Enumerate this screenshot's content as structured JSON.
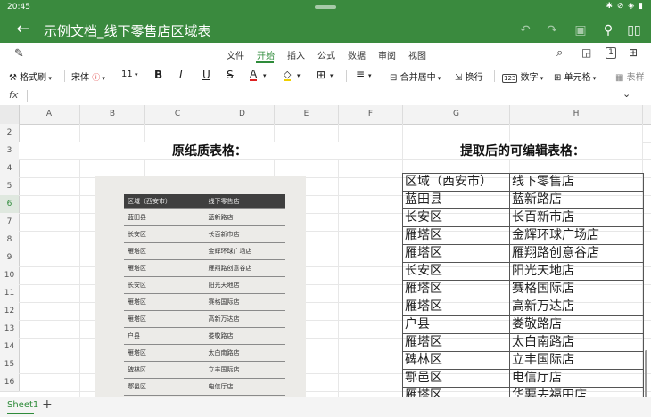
{
  "status_bar": {
    "time": "20:45",
    "icons": "✱ ⊘ ◈ ▮"
  },
  "title_bar": {
    "title": "示例文档_线下零售店区域表"
  },
  "menu_tabs": [
    "文件",
    "开始",
    "插入",
    "公式",
    "数据",
    "审阅",
    "视图"
  ],
  "toolbar": {
    "format_painter": "格式刷",
    "font_name": "宋体",
    "font_size": "11",
    "bold": "B",
    "italic": "I",
    "underline": "U",
    "strike": "S",
    "font_color": "A",
    "merge_center": "合并居中",
    "wrap": "换行",
    "number": "数字",
    "cell": "单元格",
    "table_style": "表样"
  },
  "formula_bar": {
    "fx_label": "fx",
    "value": ""
  },
  "columns": [
    "A",
    "B",
    "C",
    "D",
    "E",
    "F",
    "G",
    "H"
  ],
  "rows": [
    "2",
    "3",
    "4",
    "5",
    "6",
    "7",
    "8",
    "9",
    "10",
    "11",
    "12",
    "13",
    "14",
    "15",
    "16"
  ],
  "selected_row": "6",
  "headings": {
    "left": "原纸质表格：",
    "right": "提取后的可编辑表格："
  },
  "paper_table": {
    "header": [
      "区域（西安市）",
      "线下零售店"
    ],
    "rows": [
      [
        "蓝田县",
        "蓝新路店"
      ],
      [
        "长安区",
        "长百新市店"
      ],
      [
        "雁塔区",
        "金辉环球广场店"
      ],
      [
        "雁塔区",
        "雁翔路创意谷店"
      ],
      [
        "长安区",
        "阳光天地店"
      ],
      [
        "雁塔区",
        "赛格国际店"
      ],
      [
        "雁塔区",
        "高新万达店"
      ],
      [
        "户县",
        "娄敬路店"
      ],
      [
        "雁塔区",
        "太白南路店"
      ],
      [
        "碑林区",
        "立丰国际店"
      ],
      [
        "鄠邑区",
        "电信厅店"
      ]
    ]
  },
  "editable_table": {
    "rows": [
      [
        "区域（西安市）",
        "线下零售店"
      ],
      [
        "蓝田县",
        "蓝新路店"
      ],
      [
        "长安区",
        "长百新市店"
      ],
      [
        "雁塔区",
        "金辉环球广场店"
      ],
      [
        "雁塔区",
        "雁翔路创意谷店"
      ],
      [
        "长安区",
        "阳光天地店"
      ],
      [
        "雁塔区",
        "赛格国际店"
      ],
      [
        "雁塔区",
        "高新万达店"
      ],
      [
        "户县",
        "娄敬路店"
      ],
      [
        "雁塔区",
        "太白南路店"
      ],
      [
        "碑林区",
        "立丰国际店"
      ],
      [
        "鄠邑区",
        "电信厅店"
      ],
      [
        "雁塔区",
        "华要去福田店"
      ]
    ]
  },
  "sheet_tabs": [
    "Sheet1"
  ],
  "add_sheet": "+"
}
